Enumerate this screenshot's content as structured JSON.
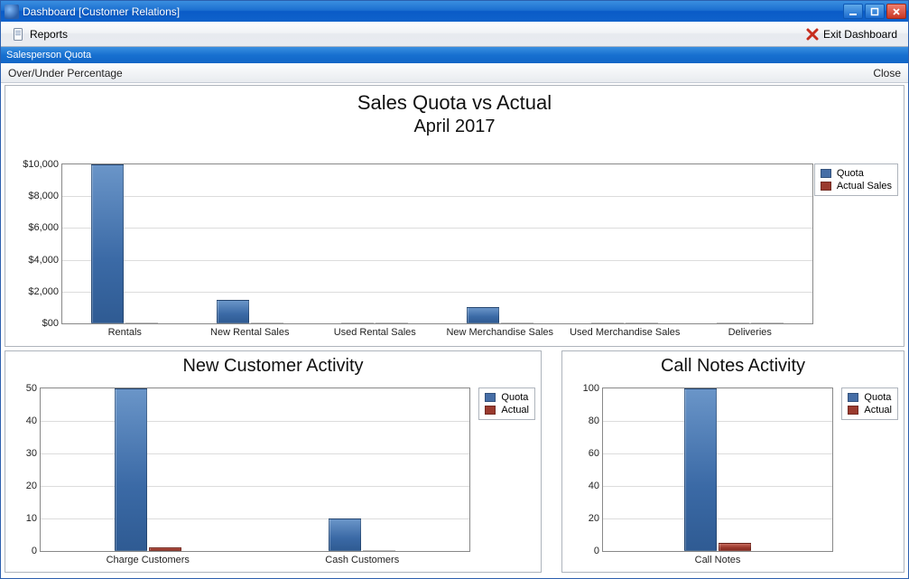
{
  "window": {
    "title": "Dashboard [Customer Relations]"
  },
  "toolbar": {
    "reports_label": "Reports",
    "exit_label": "Exit Dashboard"
  },
  "section": {
    "title": "Salesperson Quota"
  },
  "subheader": {
    "over_under_label": "Over/Under Percentage",
    "close_label": "Close"
  },
  "legend": {
    "quota": "Quota",
    "actual": "Actual Sales",
    "actual_short": "Actual"
  },
  "chart_data": [
    {
      "id": "main",
      "type": "bar",
      "title": "Sales Quota vs Actual",
      "subtitle": "April 2017",
      "ylabel": "",
      "ylim": [
        0,
        10000
      ],
      "ytick_step": 2000,
      "ytick_prefix": "$",
      "ytick_zero": "$00",
      "categories": [
        "Rentals",
        "New Rental Sales",
        "Used Rental Sales",
        "New Merchandise Sales",
        "Used Merchandise Sales",
        "Deliveries"
      ],
      "series": [
        {
          "name": "Quota",
          "values": [
            10000,
            1500,
            0,
            1000,
            0,
            0
          ]
        },
        {
          "name": "Actual Sales",
          "values": [
            0,
            0,
            0,
            0,
            0,
            0
          ]
        }
      ],
      "legend_pos": "top-right"
    },
    {
      "id": "new_customer",
      "type": "bar",
      "title": "New Customer Activity",
      "ylim": [
        0,
        50
      ],
      "ytick_step": 10,
      "categories": [
        "Charge Customers",
        "Cash Customers"
      ],
      "series": [
        {
          "name": "Quota",
          "values": [
            50,
            10
          ]
        },
        {
          "name": "Actual",
          "values": [
            1,
            0
          ]
        }
      ],
      "legend_pos": "top-right"
    },
    {
      "id": "call_notes",
      "type": "bar",
      "title": "Call Notes Activity",
      "ylim": [
        0,
        100
      ],
      "ytick_step": 20,
      "categories": [
        "Call Notes"
      ],
      "series": [
        {
          "name": "Quota",
          "values": [
            100
          ]
        },
        {
          "name": "Actual",
          "values": [
            5
          ]
        }
      ],
      "legend_pos": "top-right"
    }
  ]
}
